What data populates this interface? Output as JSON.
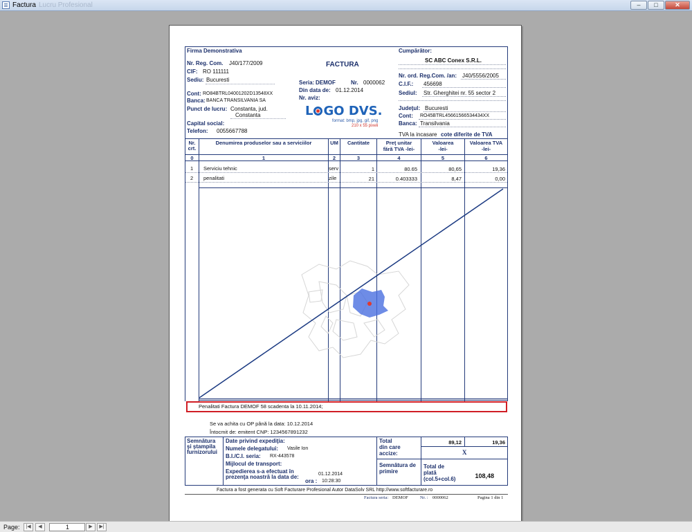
{
  "window": {
    "title": "Factura",
    "title_ghost": "Lucru Profesional"
  },
  "supplier": {
    "name": "Firma Demonstrativa",
    "reg_com_label": "Nr. Reg. Com.",
    "reg_com": "J40/177/2009",
    "cif_label": "CIF:",
    "cif": "RO 111111",
    "sediu_label": "Sediu:",
    "sediu": "Bucuresti",
    "cont_label": "Cont:",
    "cont": "RO84BTRL04001202D13548XX",
    "banca_label": "Banca:",
    "banca": "BANCA TRANSILVANIA SA",
    "punct_label": "Punct de lucru:",
    "punct_1": "Constanta, jud.",
    "punct_2": "Constanta",
    "capital_label": "Capital social:",
    "telefon_label": "Telefon:",
    "telefon": "0055667788"
  },
  "invoice": {
    "title": "FACTURA",
    "serie_label": "Seria:",
    "serie": "DEMOF",
    "nr_label": "Nr.",
    "nr": "0000062",
    "data_label": "Din data de:",
    "data": "01.12.2014",
    "aviz_label": "Nr. aviz:"
  },
  "logo": {
    "text_l": "L",
    "text_rest": "GO DVS.",
    "formats": "format: bmp, jpg, gif, png",
    "size": "210 x 55 pixeli"
  },
  "buyer": {
    "header": "Cumpărător:",
    "name": "SC ABC Conex S.R.L.",
    "reg_label": "Nr. ord. Reg.Com. /an:",
    "reg": "J40/5556/2005",
    "cif_label": "C.I.F.:",
    "cif": "456698",
    "sediu_label": "Sediul:",
    "sediu": "Str. Gherghitei nr. 55 sector 2",
    "judet_label": "Judeţul:",
    "judet": "Bucuresti",
    "cont_label": "Cont:",
    "cont": "RO45BTRL45661566534434XX",
    "banca_label": "Banca:",
    "banca": "Transilvania",
    "tva_note": "TVA la incasare",
    "tva_rates": "cote diferite de TVA"
  },
  "table": {
    "headers": {
      "nr": "Nr. crt.",
      "denumire": "Denumirea produselor sau a serviciilor",
      "um": "UM",
      "cantitate": "Cantitate",
      "pret_1": "Preţ unitar",
      "pret_2": "fără TVA -lei-",
      "valoare_1": "Valoarea",
      "valoare_2": "-lei-",
      "tva_1": "Valoarea TVA",
      "tva_2": "-lei-"
    },
    "col_numbers": [
      "0",
      "1",
      "2",
      "3",
      "4",
      "5",
      "6"
    ],
    "rows": [
      {
        "nr": "1",
        "denumire": "Serviciu tehnic",
        "um": "serv",
        "cantitate": "1",
        "pret": "80.65",
        "valoare": "80,65",
        "tva": "19,36"
      },
      {
        "nr": "2",
        "denumire": "penalitati",
        "um": "zile",
        "cantitate": "21",
        "pret": "0.403333",
        "valoare": "8,47",
        "tva": "0,00"
      }
    ]
  },
  "note": "Penalitati Factura DEMOF 58 scadenta la 10.11.2014;",
  "payment_line": "Se va achita cu OP până la data: 10.12.2014",
  "issuer_line": "Întocmit de: emitent  CNP: 1234567891232",
  "footer": {
    "semnatura_furnizor_1": "Semnătura",
    "semnatura_furnizor_2": "şi ştampila",
    "semnatura_furnizor_3": "furnizorului",
    "expeditie_label": "Date privind expediţia:",
    "delegat_label": "Numele delegatului:",
    "delegat": "Vasile Ion",
    "bi_label": "B.I./C.I. seria:",
    "bi": "RX-443578",
    "transport_label": "Mijlocul de transport:",
    "exped_1": "Expedierea s-a efectuat în",
    "exped_2": "prezenţa noastră la data de:",
    "exped_data": "01.12.2014",
    "ora_label": "ora :",
    "ora": "10:28:30",
    "total_label_1": "Total",
    "total_label_2": "din care",
    "total_label_3": "accize:",
    "total_valoare": "89,12",
    "total_tva": "19,36",
    "accize_mark": "X",
    "semn_primire_1": "Semnătura de",
    "semn_primire_2": "primire",
    "total_plata_1": "Total de",
    "total_plata_2": "plată",
    "total_plata_3": "(col.5+col.6)",
    "total_plata": "108,48",
    "generated": "Factura a fost generata cu Soft Facturare Profesional Autor DataSolv SRL http://www.softfacturare.ro",
    "foot_serie_label": "Factura seria:",
    "foot_serie": "DEMOF",
    "foot_nr_label": "Nr. :",
    "foot_nr": "0000062",
    "foot_page": "Pagina 1 din 1"
  },
  "statusbar": {
    "page_label": "Page:",
    "page_value": "1"
  }
}
